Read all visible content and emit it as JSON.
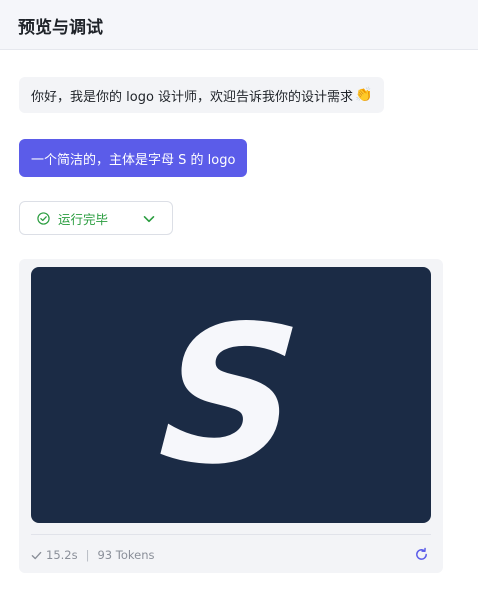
{
  "header": {
    "title": "预览与调试"
  },
  "messages": {
    "bot_greeting": "你好，我是你的 logo 设计师，欢迎告诉我你的设计需求",
    "bot_emoji": "👏",
    "user_request": "一个简洁的，主体是字母 S 的 logo"
  },
  "run_status": {
    "label": "运行完毕",
    "icon": "check-circle-icon",
    "color": "#2a9d3f"
  },
  "result": {
    "logo_letter": "S",
    "logo_background": "#1b2b45",
    "duration": "15.2s",
    "tokens": "93 Tokens"
  },
  "colors": {
    "accent": "#5b5ce9",
    "success": "#2a9d3f"
  }
}
